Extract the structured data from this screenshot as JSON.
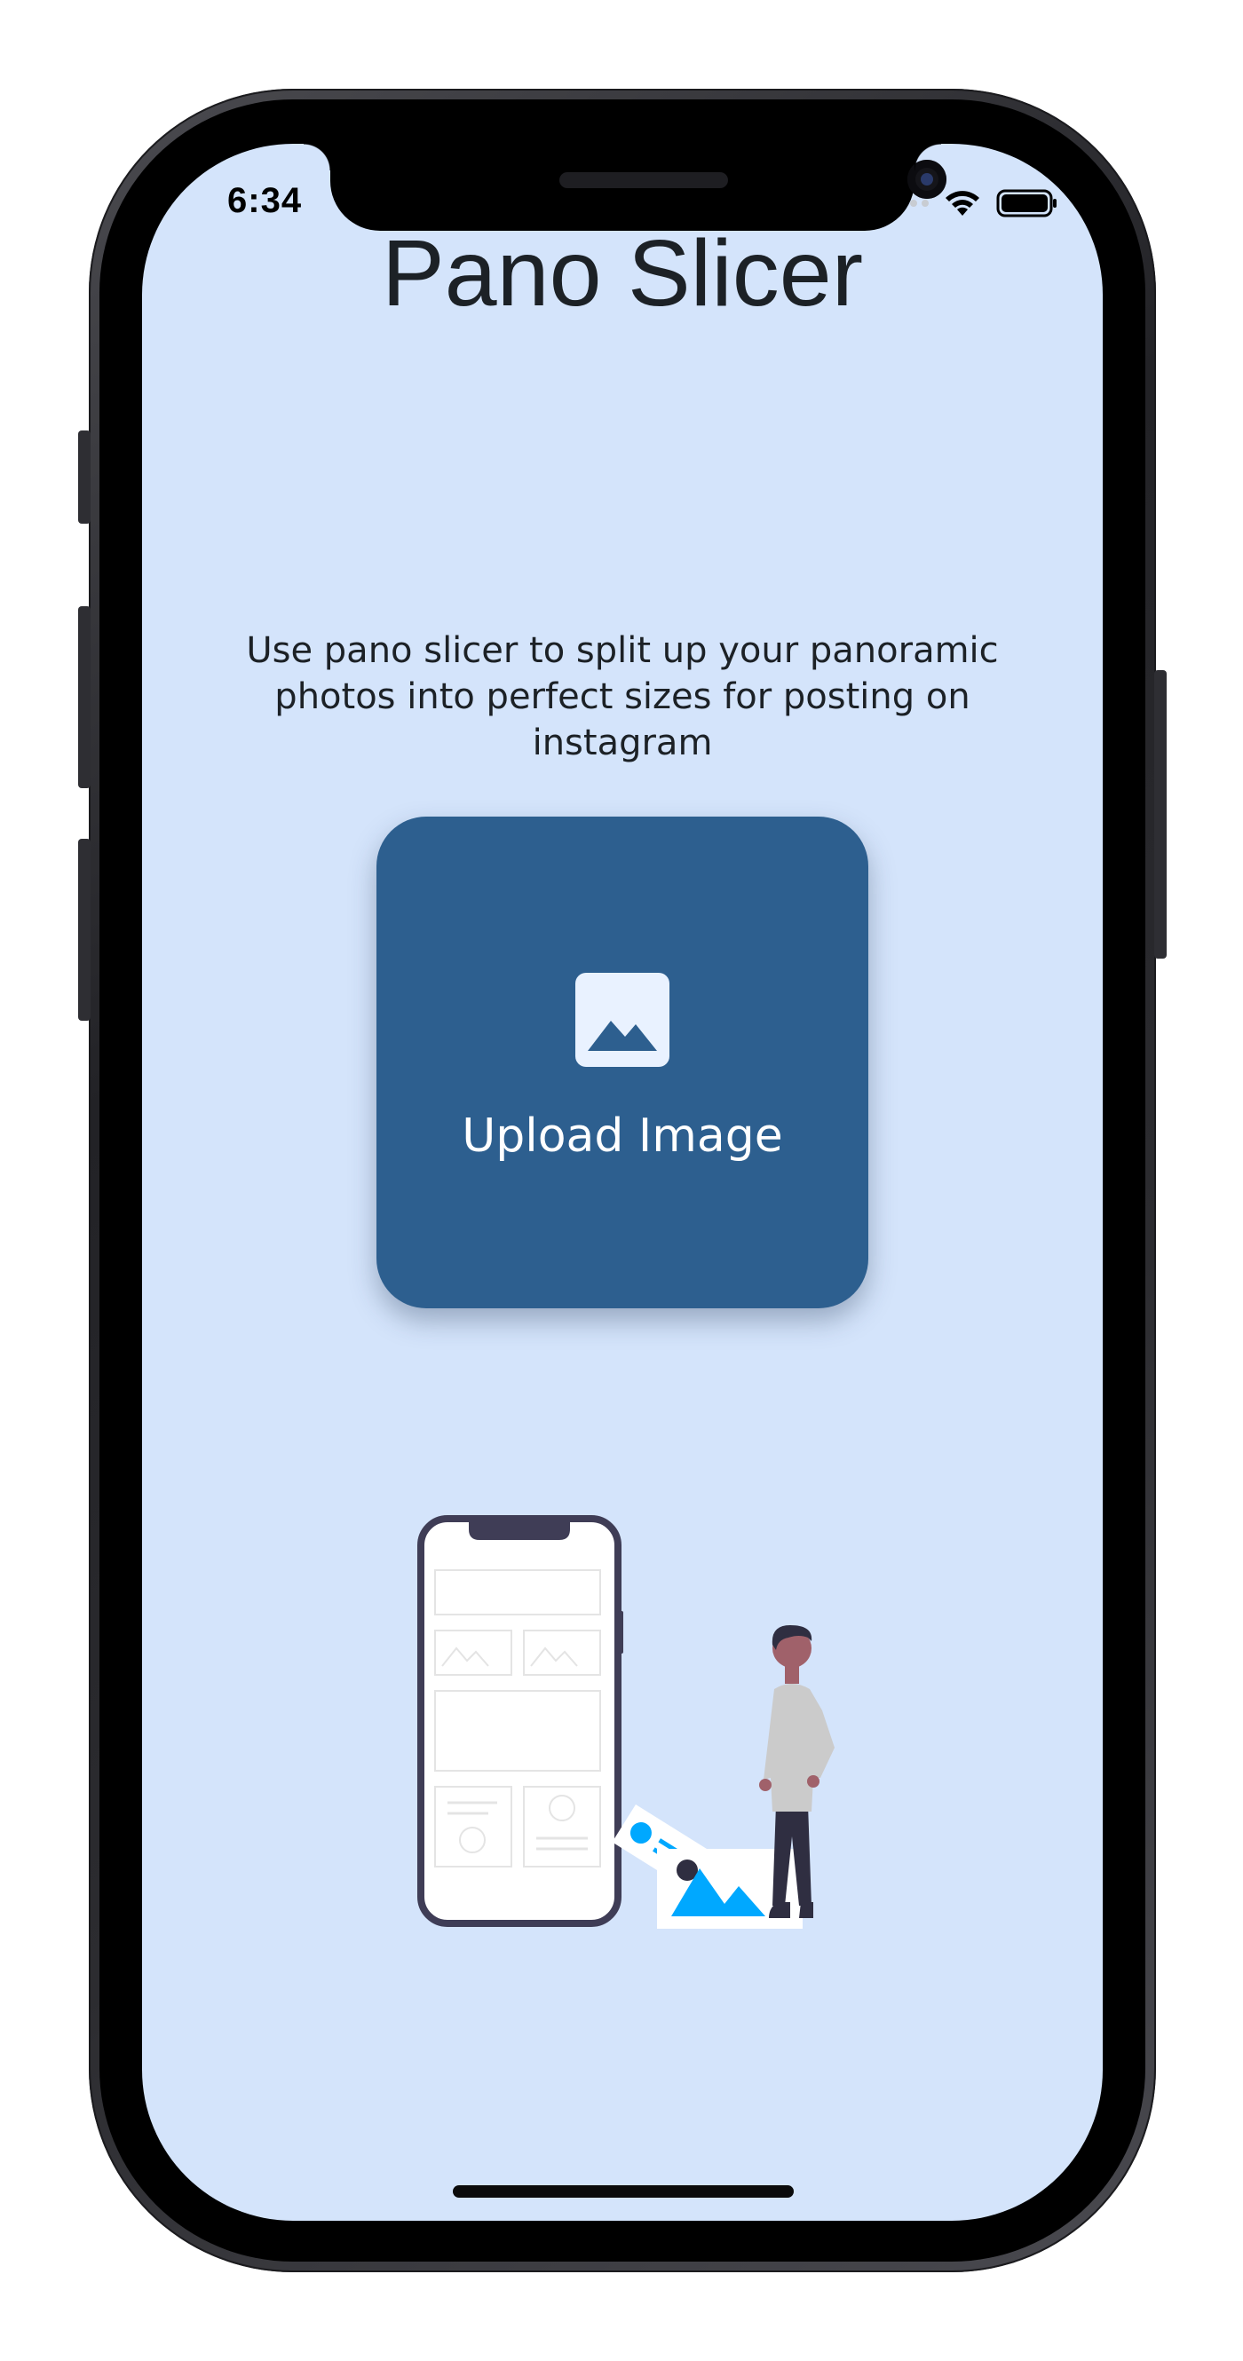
{
  "status_bar": {
    "time": "6:34"
  },
  "app": {
    "title": "Pano Slicer",
    "description": "Use pano slicer to split up your panoramic photos into perfect sizes for posting on instagram"
  },
  "upload": {
    "label": "Upload Image",
    "icon": "image-icon",
    "color": "#2d5f8f"
  },
  "colors": {
    "background": "#d4e4fb",
    "accent": "#00a8ff",
    "text": "#1c2126"
  }
}
